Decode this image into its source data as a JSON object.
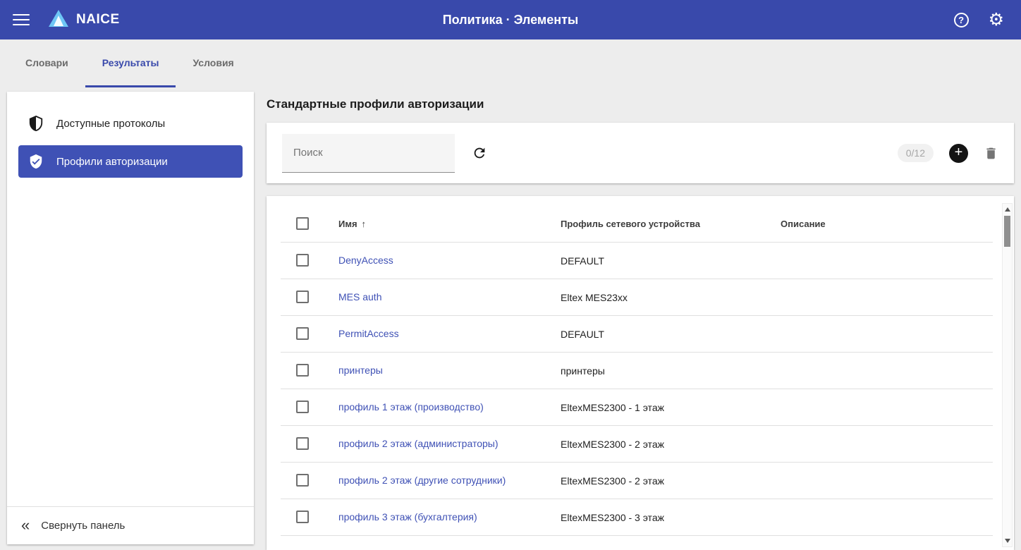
{
  "header": {
    "app_name": "NAICE",
    "title": "Политика · Элементы"
  },
  "tabs": [
    {
      "label": "Словари",
      "active": false
    },
    {
      "label": "Результаты",
      "active": true
    },
    {
      "label": "Условия",
      "active": false
    }
  ],
  "sidebar": {
    "items": [
      {
        "label": "Доступные протоколы",
        "active": false
      },
      {
        "label": "Профили авторизации",
        "active": true
      }
    ],
    "collapse_label": "Свернуть панель"
  },
  "main": {
    "title": "Стандартные профили авторизации",
    "toolbar": {
      "search_placeholder": "Поиск",
      "selection_count": "0/12"
    },
    "table": {
      "columns": [
        "Имя",
        "Профиль сетевого устройства",
        "Описание"
      ],
      "rows": [
        {
          "name": "DenyAccess",
          "device_profile": "DEFAULT",
          "description": ""
        },
        {
          "name": "MES auth",
          "device_profile": "Eltex MES23xx",
          "description": ""
        },
        {
          "name": "PermitAccess",
          "device_profile": "DEFAULT",
          "description": ""
        },
        {
          "name": "принтеры",
          "device_profile": "принтеры",
          "description": ""
        },
        {
          "name": "профиль 1 этаж (производство)",
          "device_profile": "EltexMES2300 - 1 этаж",
          "description": ""
        },
        {
          "name": "профиль 2 этаж (администраторы)",
          "device_profile": "EltexMES2300 - 2 этаж",
          "description": ""
        },
        {
          "name": "профиль 2 этаж (другие сотрудники)",
          "device_profile": "EltexMES2300 - 2 этаж",
          "description": ""
        },
        {
          "name": "профиль 3 этаж (бухгалтерия)",
          "device_profile": "EltexMES2300 - 3 этаж",
          "description": ""
        }
      ]
    }
  },
  "icons": {
    "help": "?",
    "gear": "⚙",
    "plus": "+",
    "collapse": "«",
    "sort_asc": "↑"
  },
  "colors": {
    "header_bg": "#3949ab",
    "accent": "#3f51b5",
    "link": "#3f51b5",
    "page_bg": "#ededed"
  }
}
